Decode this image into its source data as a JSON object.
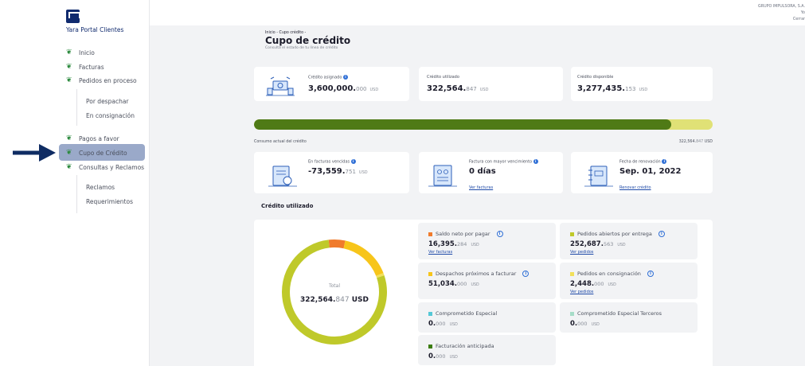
{
  "portal_title": "Yara Portal Clientes",
  "header": {
    "company": "GRUPO IMPULSORA, S.A.",
    "user": "Yo",
    "close": "Cerrar"
  },
  "nav": {
    "inicio": "Inicio",
    "facturas": "Facturas",
    "pedidos": "Pedidos en proceso",
    "por_despachar": "Por despachar",
    "en_consignacion": "En consignación",
    "pagos": "Pagos a favor",
    "cupo": "Cupo de Crédito",
    "consultas": "Consultas y Reclamos",
    "reclamos": "Reclamos",
    "requerimientos": "Requerimientos"
  },
  "page": {
    "breadcrumb": "Inicio - Cupo crédito -",
    "title": "Cupo de crédito",
    "subtitle": "Consulta el estado de tu línea de crédito"
  },
  "summary": {
    "asignado_label": "Crédito asignado",
    "asignado_int": "3,600,000.",
    "asignado_dec": "000",
    "utilizado_label": "Crédito utilizado",
    "utilizado_int": "322,564.",
    "utilizado_dec": "847",
    "disponible_label": "Crédito disponible",
    "disponible_int": "3,277,435.",
    "disponible_dec": "153",
    "currency": "USD"
  },
  "progress": {
    "used_fraction": 0.9104
  },
  "consumo": {
    "label": "Consumo actual del crédito",
    "value_int": "322,564.",
    "value_dec": "847",
    "currency": "USD"
  },
  "details": {
    "vencidas_label": "En facturas vencidas",
    "vencidas_int": "-73,559.",
    "vencidas_dec": "751",
    "vencimiento_label": "Factura con mayor vencimiento",
    "vencimiento_value": "0 días",
    "vencimiento_link": "Ver facturas",
    "renovacion_label": "Fecha de renovación",
    "renovacion_value": "Sep. 01, 2022",
    "renovacion_link": "Renovar crédito"
  },
  "credito_utilizado": {
    "title": "Crédito utilizado",
    "total_label": "Total",
    "total_int": "322,564.",
    "total_dec": "847",
    "currency": "USD"
  },
  "segments": {
    "saldo_label": "Saldo neto por pagar",
    "saldo_int": "16,395.",
    "saldo_dec": "284",
    "saldo_link": "Ver facturas",
    "saldo_color": "#f07b2c",
    "abiertos_label": "Pedidos abiertos por entrega",
    "abiertos_int": "252,687.",
    "abiertos_dec": "563",
    "abiertos_link": "Ver pedidos",
    "abiertos_color": "#bfc92a",
    "despachos_label": "Despachos próximos a facturar",
    "despachos_int": "51,034.",
    "despachos_dec": "000",
    "despachos_color": "#f7c51a",
    "consignacion_label": "Pedidos en consignación",
    "consignacion_int": "2,448.",
    "consignacion_dec": "000",
    "consignacion_link": "Ver pedidos",
    "consignacion_color": "#f2e05a",
    "especial_label": "Comprometido Especial",
    "especial_int": "0.",
    "especial_dec": "000",
    "especial_color": "#55c8d6",
    "terceros_label": "Comprometido Especial Terceros",
    "terceros_int": "0.",
    "terceros_dec": "000",
    "terceros_color": "#a6dcc8",
    "anticipada_label": "Facturación anticipada",
    "anticipada_int": "0.",
    "anticipada_dec": "000",
    "anticipada_color": "#3c7d10",
    "currency": "USD"
  }
}
